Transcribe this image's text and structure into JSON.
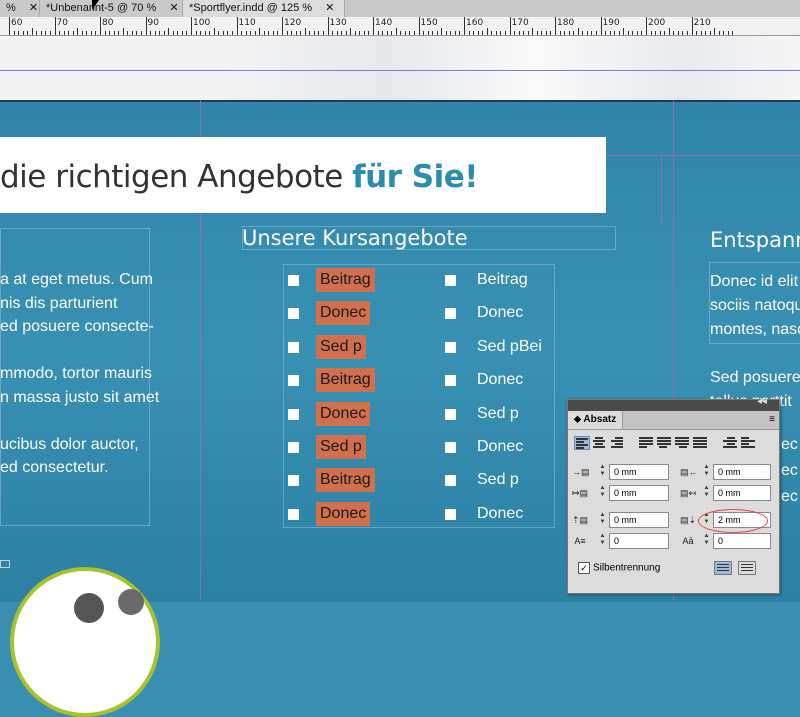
{
  "tabs": [
    {
      "label": "%",
      "close": "✕"
    },
    {
      "label": "*Unbenannt-5 @ 70 %",
      "close": "✕"
    },
    {
      "label": "*Sportflyer.indd @ 125 %",
      "close": "✕"
    }
  ],
  "ruler": {
    "labels": [
      "60",
      "70",
      "80",
      "90",
      "100",
      "110",
      "120",
      "130",
      "140",
      "150",
      "160",
      "170",
      "180",
      "190",
      "200",
      "210"
    ]
  },
  "headline": {
    "text": "die richtigen Angebote ",
    "highlight": "für Sie!"
  },
  "left_column": {
    "lines": [
      "a at eget metus. Cum",
      "nis dis parturient",
      "ed posuere consecte-",
      "",
      "mmodo, tortor mauris",
      "n massa justo sit amet",
      "",
      "ucibus dolor auctor,",
      "ed consectetur."
    ]
  },
  "middle_column": {
    "title": "Unsere Kursangebote",
    "list_a": [
      "Beitrag",
      "Donec",
      "Sed p",
      "Beitrag",
      "Donec",
      "Sed p",
      "Beitrag",
      "Donec"
    ],
    "list_b": [
      "Beitrag",
      "Donec",
      "Sed pBei",
      "Donec",
      "Sed p",
      "Donec",
      "Sed p",
      "Donec"
    ]
  },
  "right_column": {
    "title": "Entspanne",
    "lines": [
      "Donec id elit",
      "sociis natoqu",
      "montes, nasc",
      "",
      "Sed posuere ",
      "tellus porttit",
      "",
      "",
      "",
      "",
      "Donec"
    ],
    "partial_lines": [
      "ec",
      "ec",
      "ec"
    ]
  },
  "panel": {
    "tab_label": "Absatz",
    "menu_icon": "≡",
    "collapse_icon": "◂◂",
    "close_icon": "✕",
    "fields": {
      "left_indent": "0 mm",
      "right_indent": "0 mm",
      "first_line_indent": "0 mm",
      "last_line_indent": "0 mm",
      "space_before": "0 mm",
      "space_after": "2 mm",
      "dropcap_lines": "0",
      "dropcap_chars": "0"
    },
    "hyphenation_label": "Silbentrennung",
    "hyphenation_checked": "✓"
  },
  "colors": {
    "page": "#3a8fb0",
    "highlight": "#d2704e",
    "headline_accent": "#2a8db0",
    "ring": "#e04848",
    "circle_border": "#a8c22e"
  }
}
